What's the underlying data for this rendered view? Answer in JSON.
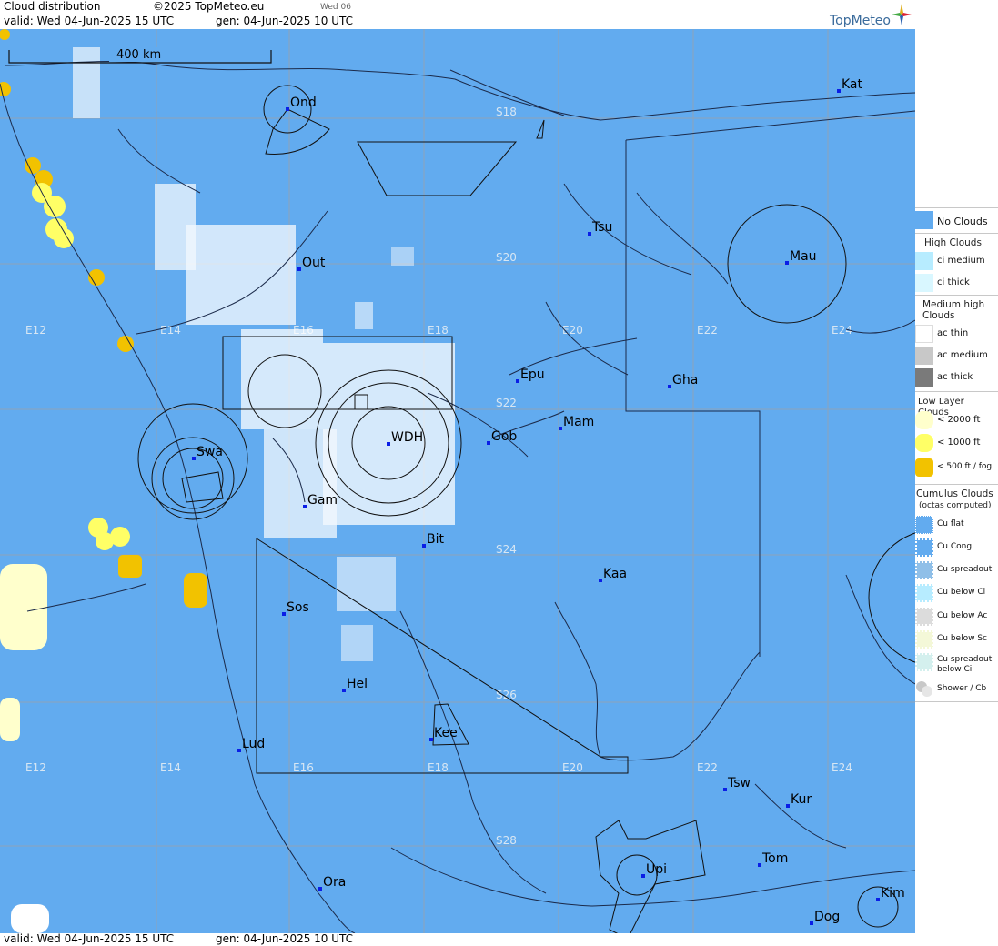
{
  "header": {
    "title": "Cloud distribution",
    "copyright": "©2025 TopMeteo.eu",
    "day_tab": "Wed 06",
    "valid": "valid:  Wed  04-Jun-2025  15 UTC",
    "generated": "gen: 04-Jun-2025 10 UTC",
    "brand": "TopMeteo"
  },
  "footer": {
    "valid": "valid:  Wed  04-Jun-2025  15 UTC",
    "generated": "gen: 04-Jun-2025 10 UTC"
  },
  "map": {
    "scale_label": "400 km",
    "colors": {
      "background": "#62abef",
      "grid": "#8ea3b8",
      "line": "#1b2a4a"
    },
    "longitude_labels": [
      "E12",
      "E14",
      "E16",
      "E18",
      "E20",
      "E22",
      "E24"
    ],
    "latitude_labels": [
      "S18",
      "S20",
      "S22",
      "S24",
      "S26",
      "S28"
    ],
    "places": [
      {
        "code": "Ond"
      },
      {
        "code": "Kat"
      },
      {
        "code": "Tsu"
      },
      {
        "code": "Out"
      },
      {
        "code": "Mau"
      },
      {
        "code": "Epu"
      },
      {
        "code": "Gha"
      },
      {
        "code": "Mam"
      },
      {
        "code": "WDH"
      },
      {
        "code": "Gob"
      },
      {
        "code": "Swa"
      },
      {
        "code": "Gam"
      },
      {
        "code": "Bit"
      },
      {
        "code": "Kaa"
      },
      {
        "code": "Sos"
      },
      {
        "code": "Hel"
      },
      {
        "code": "Kee"
      },
      {
        "code": "Lud"
      },
      {
        "code": "Tsw"
      },
      {
        "code": "Kur"
      },
      {
        "code": "Tom"
      },
      {
        "code": "Upi"
      },
      {
        "code": "Ora"
      },
      {
        "code": "Kim"
      },
      {
        "code": "Dog"
      }
    ]
  },
  "legend": {
    "no_clouds": "No Clouds",
    "high_clouds": {
      "title": "High Clouds",
      "items": [
        "ci medium",
        "ci thick"
      ]
    },
    "medium_clouds": {
      "title": "Medium high Clouds",
      "items": [
        "ac thin",
        "ac medium",
        "ac thick"
      ]
    },
    "low_clouds": {
      "title": "Low Layer Clouds",
      "items": [
        "< 2000 ft",
        "< 1000 ft",
        "< 500 ft / fog"
      ]
    },
    "cumulus": {
      "title": "Cumulus Clouds",
      "subtitle": "(octas computed)",
      "items": [
        "Cu flat",
        "Cu Cong",
        "Cu spreadout",
        "Cu below Ci",
        "Cu below Ac",
        "Cu below Sc",
        "Cu spreadout below Ci",
        "Shower / Cb"
      ]
    },
    "colors": {
      "no_clouds": "#62abef",
      "ci_medium": "#b7ecff",
      "ci_thick": "#d9f7ff",
      "ac_thin": "#ffffff",
      "ac_medium": "#c8c8c8",
      "ac_thick": "#7a7a7a",
      "low_2000": "#ffffcc",
      "low_1000": "#ffff66",
      "low_500": "#f2c200"
    }
  }
}
